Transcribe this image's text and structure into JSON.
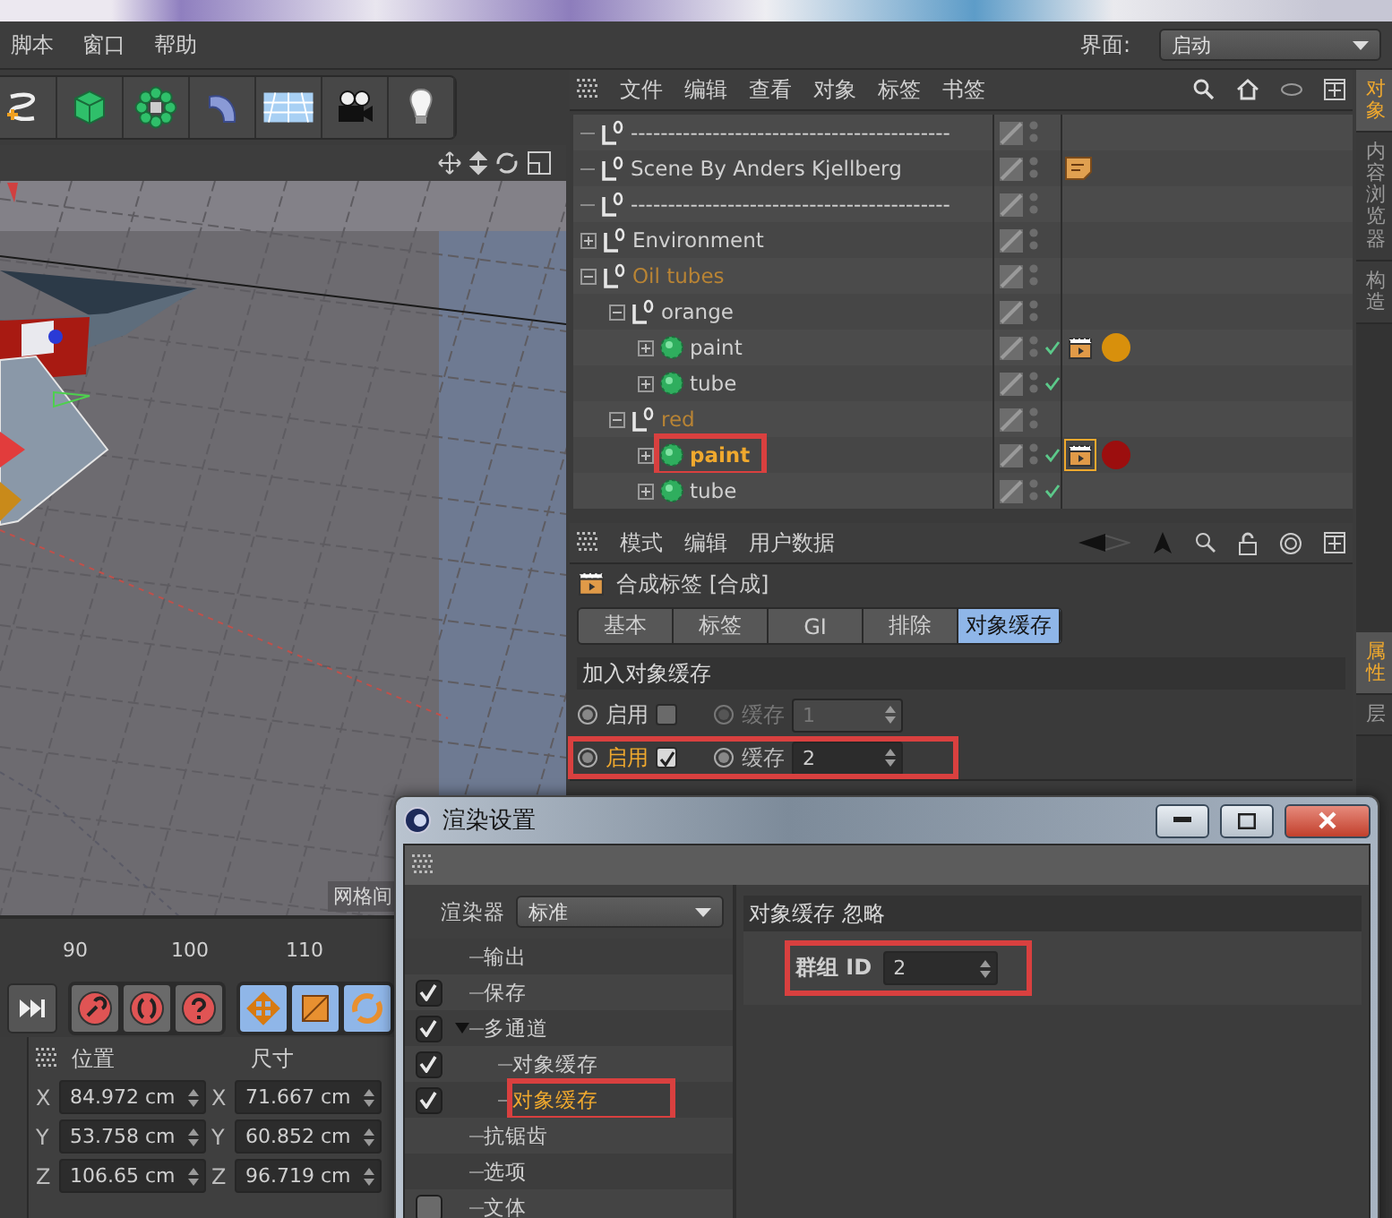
{
  "menu": [
    "脚本",
    "窗口",
    "帮助"
  ],
  "layout_selector": {
    "label": "界面:",
    "value": "启动"
  },
  "viewport": {
    "grid_label": "网格间"
  },
  "timeline": {
    "ticks": [
      "90",
      "100",
      "110"
    ]
  },
  "coordinates": {
    "headers": [
      "位置",
      "尺寸"
    ],
    "rows": [
      {
        "axis": "X",
        "position": "84.972 cm",
        "size_axis": "X",
        "size": "71.667 cm"
      },
      {
        "axis": "Y",
        "position": "53.758 cm",
        "size_axis": "Y",
        "size": "60.852 cm"
      },
      {
        "axis": "Z",
        "position": "106.65 cm",
        "size_axis": "Z",
        "size": "96.719 cm"
      }
    ]
  },
  "object_manager": {
    "menu": [
      "文件",
      "编辑",
      "查看",
      "对象",
      "标签",
      "书签"
    ],
    "objects": [
      {
        "name": "-------------------------------------------",
        "kind": "null",
        "selected": false,
        "active_parent": false
      },
      {
        "name": "Scene By Anders Kjellberg",
        "kind": "null",
        "selected": false,
        "active_parent": false,
        "tags": [
          {
            "kind": "note"
          }
        ]
      },
      {
        "name": "-------------------------------------------",
        "kind": "null",
        "selected": false,
        "active_parent": false
      },
      {
        "name": "Environment",
        "kind": "null",
        "selected": false,
        "active_parent": false,
        "expanded": false
      },
      {
        "name": "Oil tubes",
        "kind": "null",
        "selected": false,
        "active_parent": true,
        "expanded": true,
        "children": [
          {
            "name": "orange",
            "kind": "null",
            "selected": false,
            "active_parent": false,
            "expanded": true,
            "children": [
              {
                "name": "paint",
                "kind": "polygon",
                "selected": false,
                "active_parent": false,
                "expanded": false,
                "enabled": true,
                "tags": [
                  {
                    "kind": "render",
                    "selected": false
                  },
                  {
                    "kind": "material",
                    "color": "#d8900c"
                  }
                ]
              },
              {
                "name": "tube",
                "kind": "polygon",
                "selected": false,
                "active_parent": false,
                "expanded": false,
                "enabled": true
              }
            ]
          },
          {
            "name": "red",
            "kind": "null",
            "selected": false,
            "active_parent": true,
            "expanded": true,
            "children": [
              {
                "name": "paint",
                "kind": "polygon",
                "selected": true,
                "active_parent": false,
                "expanded": false,
                "enabled": true,
                "annotated": true,
                "tags": [
                  {
                    "kind": "render",
                    "selected": true
                  },
                  {
                    "kind": "material",
                    "color": "#9c0e0e"
                  }
                ]
              },
              {
                "name": "tube",
                "kind": "polygon",
                "selected": false,
                "active_parent": false,
                "expanded": false,
                "enabled": true
              }
            ]
          }
        ]
      }
    ]
  },
  "attributes": {
    "menu": [
      "模式",
      "编辑",
      "用户数据"
    ],
    "title": "合成标签 [合成]",
    "tabs": [
      {
        "label": "基本",
        "selected": false
      },
      {
        "label": "标签",
        "selected": false
      },
      {
        "label": "GI",
        "selected": false
      },
      {
        "label": "排除",
        "selected": false
      },
      {
        "label": "对象缓存",
        "selected": true
      }
    ],
    "section": "加入对象缓存",
    "rows": [
      {
        "label": "启用",
        "active": false,
        "checked": false,
        "buffer_label": "缓存",
        "buffer_disabled": true,
        "value": "1"
      },
      {
        "label": "启用",
        "active": true,
        "checked": true,
        "buffer_label": "缓存",
        "buffer_disabled": false,
        "value": "2",
        "annotated": true
      }
    ]
  },
  "side_tabs_top": [
    {
      "label": "对象",
      "selected": true
    },
    {
      "label": "内容浏览器",
      "selected": false
    },
    {
      "label": "构造",
      "selected": false
    }
  ],
  "side_tabs_bottom": [
    {
      "label": "属性",
      "selected": true
    },
    {
      "label": "层",
      "selected": false
    }
  ],
  "render_dialog": {
    "title": "渲染设置",
    "renderer_label": "渲染器",
    "renderer": "标准",
    "items": [
      {
        "label": "输出",
        "selected": false
      },
      {
        "label": "保存",
        "checked": true,
        "selected": false
      },
      {
        "label": "多通道",
        "checked": true,
        "selected": false,
        "expanded": true,
        "children": [
          {
            "label": "对象缓存",
            "checked": true,
            "selected": false
          },
          {
            "label": "对象缓存",
            "checked": true,
            "selected": true,
            "annotated": true
          }
        ]
      },
      {
        "label": "抗锯齿",
        "selected": false
      },
      {
        "label": "选项",
        "selected": false
      },
      {
        "label": "文体",
        "checked": false,
        "selected": false
      }
    ],
    "section": "对象缓存 忽略",
    "field": {
      "label": "群组 ID",
      "value": "2",
      "annotated": true
    }
  }
}
